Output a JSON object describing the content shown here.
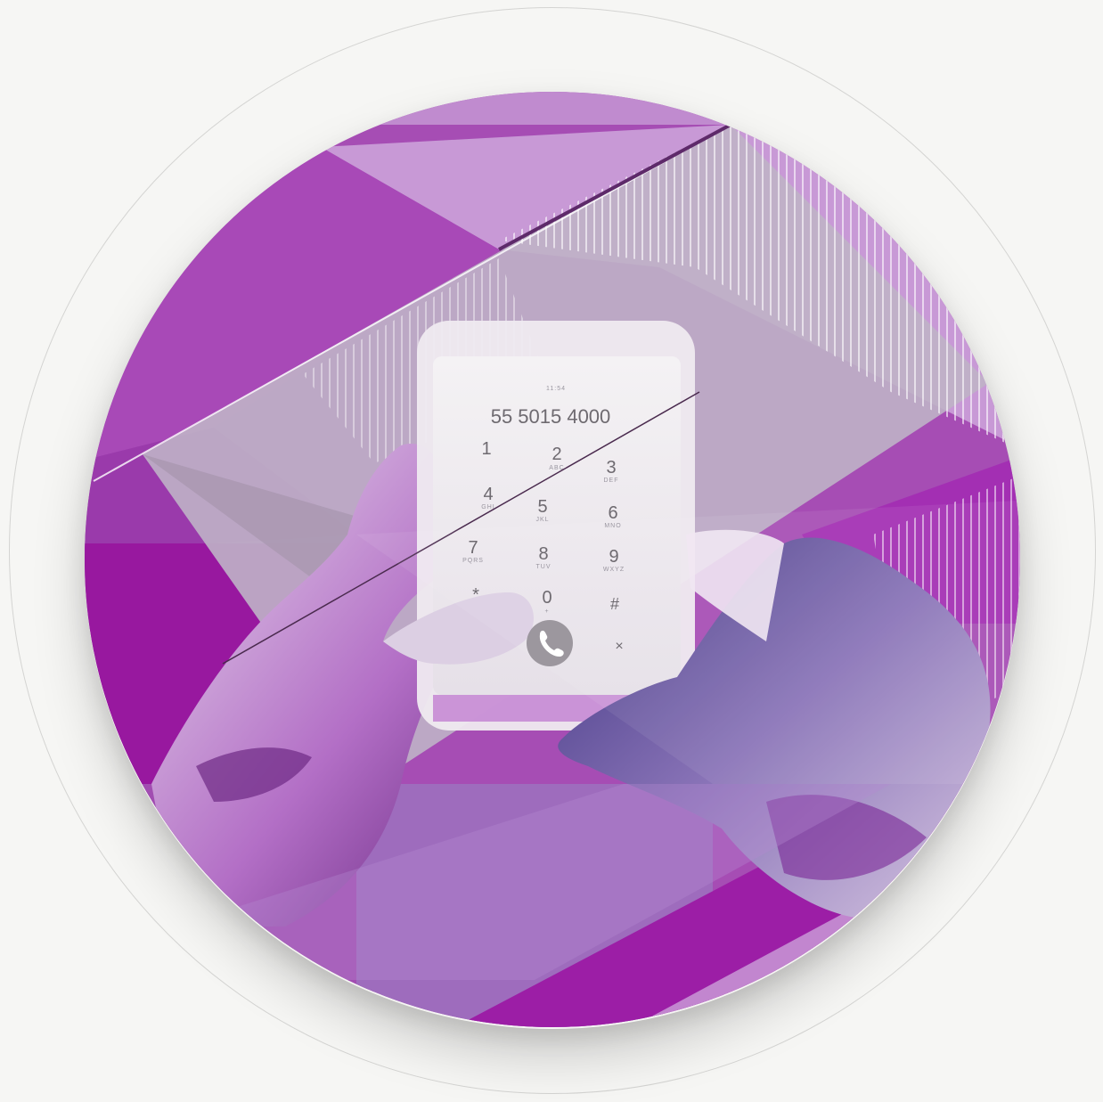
{
  "phone": {
    "status_time": "11:54",
    "dialed_number": "55 5015 4000",
    "keys": [
      {
        "digit": "1",
        "letters": ""
      },
      {
        "digit": "2",
        "letters": "ABC"
      },
      {
        "digit": "3",
        "letters": "DEF"
      },
      {
        "digit": "4",
        "letters": "GHI"
      },
      {
        "digit": "5",
        "letters": "JKL"
      },
      {
        "digit": "6",
        "letters": "MNO"
      },
      {
        "digit": "7",
        "letters": "PQRS"
      },
      {
        "digit": "8",
        "letters": "TUV"
      },
      {
        "digit": "9",
        "letters": "WXYZ"
      },
      {
        "digit": "*",
        "letters": ""
      },
      {
        "digit": "0",
        "letters": "+"
      },
      {
        "digit": "#",
        "letters": ""
      }
    ],
    "delete_symbol": "×"
  },
  "colors": {
    "background": "#f6f6f4",
    "purple_dark": "#8e1b9c",
    "purple_mid": "#a23fb0",
    "purple_light": "#c38fd2",
    "lilac": "#b9a7c4",
    "skin_shadow": "#6a2a8a",
    "hand_blue": "#4d3d8e"
  }
}
